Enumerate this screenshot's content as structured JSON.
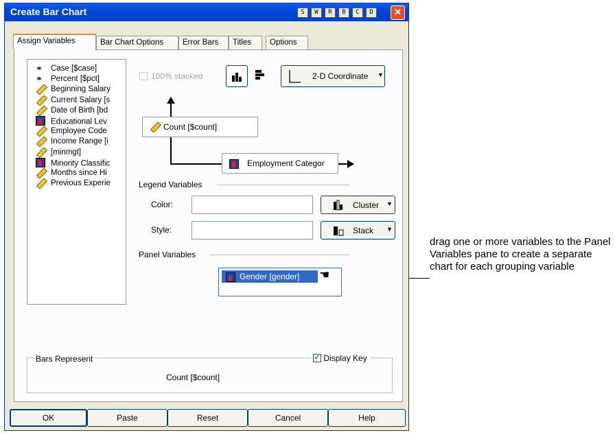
{
  "window": {
    "title": "Create Bar Chart",
    "title_buttons": [
      "S",
      "W",
      "R",
      "B",
      "C",
      "D"
    ],
    "close_glyph": "✕"
  },
  "tabs": [
    "Assign Variables",
    "Bar Chart Options",
    "Error Bars",
    "Titles",
    "Options"
  ],
  "variables": [
    {
      "label": "Case [$case]",
      "icon": "scale-icon"
    },
    {
      "label": "Percent [$pct]",
      "icon": "scale-icon"
    },
    {
      "label": "Beginning Salary",
      "icon": "ruler-icon"
    },
    {
      "label": "Current Salary [s",
      "icon": "ruler-icon"
    },
    {
      "label": "Date of Birth [bd",
      "icon": "ruler-icon"
    },
    {
      "label": "Educational Lev",
      "icon": "nominal-icon"
    },
    {
      "label": "Employee Code",
      "icon": "ruler-icon"
    },
    {
      "label": "Income Range [i",
      "icon": "ruler-icon"
    },
    {
      "label": "[minmgt]",
      "icon": "ruler-icon"
    },
    {
      "label": "Minority Classific",
      "icon": "nominal-icon"
    },
    {
      "label": "Months since Hi",
      "icon": "ruler-icon"
    },
    {
      "label": "Previous Experie",
      "icon": "ruler-icon"
    }
  ],
  "options": {
    "stacked_label": "100% stacked",
    "coordinate_label": "2-D Coordinate"
  },
  "y_axis_var": "Count [$count]",
  "x_axis_var": "Employment Categor",
  "legend": {
    "group_label": "Legend Variables",
    "color_label": "Color:",
    "color_value": "",
    "style_label": "Style:",
    "style_value": "",
    "cluster_label": "Cluster",
    "stack_label": "Stack"
  },
  "panel": {
    "group_label": "Panel Variables",
    "var": "Gender [gender]"
  },
  "bars_represent": {
    "group_label": "Bars Represent",
    "display_key_label": "Display Key",
    "display_key_checked": true,
    "value": "Count [$count]"
  },
  "buttons": {
    "ok": "OK",
    "paste": "Paste",
    "reset": "Reset",
    "cancel": "Cancel",
    "help": "Help"
  },
  "annotation": "drag one or more variables to the Panel Variables pane to create a separate chart for each grouping variable",
  "colors": {
    "titlebar": "#0246d6",
    "dialog_bg": "#ece9d8",
    "selection": "#316ac5"
  }
}
